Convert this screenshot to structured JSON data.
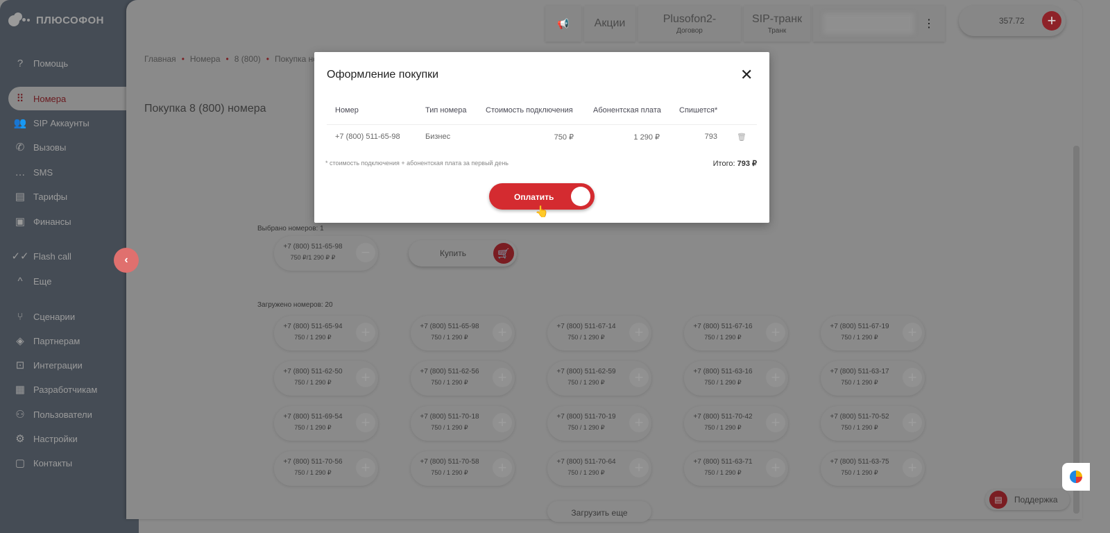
{
  "app": {
    "logo": "ПЛЮСОФОН"
  },
  "sidebar": {
    "items": [
      {
        "label": "Помощь",
        "icon": "help-icon"
      },
      {
        "label": "Номера",
        "icon": "dialpad-icon",
        "active": true
      },
      {
        "label": "SIP Аккаунты",
        "icon": "people-icon"
      },
      {
        "label": "Вызовы",
        "icon": "phone-icon"
      },
      {
        "label": "SMS",
        "icon": "sms-icon"
      },
      {
        "label": "Тарифы",
        "icon": "tariff-icon"
      },
      {
        "label": "Финансы",
        "icon": "wallet-icon"
      },
      {
        "label": "Flash call",
        "icon": "double-check-icon"
      },
      {
        "label": "Еще",
        "icon": "chevron-up-icon"
      },
      {
        "label": "Сценарии",
        "icon": "split-icon"
      },
      {
        "label": "Партнерам",
        "icon": "tag-icon"
      },
      {
        "label": "Интеграции",
        "icon": "integration-icon"
      },
      {
        "label": "Разработчикам",
        "icon": "code-icon"
      },
      {
        "label": "Пользователи",
        "icon": "users-icon"
      },
      {
        "label": "Настройки",
        "icon": "gear-icon"
      },
      {
        "label": "Контакты",
        "icon": "contacts-icon"
      }
    ]
  },
  "header": {
    "promo": "Акции",
    "contract": "Plusofon2-",
    "contract_label": "Договор",
    "trunk": "SIP-транк",
    "trunk_label": "Транк",
    "balance": "357.72"
  },
  "breadcrumb": [
    "Главная",
    "Номера",
    "8 (800)",
    "Покупка номера"
  ],
  "page": {
    "title": "Покупка 8 (800) номера",
    "selected_label": "Выбрано номеров: 1",
    "loaded_label": "Загружено номеров: 20",
    "buy_label": "Купить",
    "load_more": "Загрузить еще",
    "support": "Поддержка",
    "selected": [
      {
        "number": "+7 (800) 511-65-98",
        "price": "750 ₽/1 290 ₽ ₽"
      }
    ],
    "numbers": [
      {
        "number": "+7 (800) 511-65-94",
        "price": "750 / 1 290 ₽"
      },
      {
        "number": "+7 (800) 511-65-98",
        "price": "750 / 1 290 ₽"
      },
      {
        "number": "+7 (800) 511-67-14",
        "price": "750 / 1 290 ₽"
      },
      {
        "number": "+7 (800) 511-67-16",
        "price": "750 / 1 290 ₽"
      },
      {
        "number": "+7 (800) 511-67-19",
        "price": "750 / 1 290 ₽"
      },
      {
        "number": "+7 (800) 511-62-50",
        "price": "750 / 1 290 ₽"
      },
      {
        "number": "+7 (800) 511-62-56",
        "price": "750 / 1 290 ₽"
      },
      {
        "number": "+7 (800) 511-62-59",
        "price": "750 / 1 290 ₽"
      },
      {
        "number": "+7 (800) 511-63-16",
        "price": "750 / 1 290 ₽"
      },
      {
        "number": "+7 (800) 511-63-17",
        "price": "750 / 1 290 ₽"
      },
      {
        "number": "+7 (800) 511-69-54",
        "price": "750 / 1 290 ₽"
      },
      {
        "number": "+7 (800) 511-70-18",
        "price": "750 / 1 290 ₽"
      },
      {
        "number": "+7 (800) 511-70-19",
        "price": "750 / 1 290 ₽"
      },
      {
        "number": "+7 (800) 511-70-42",
        "price": "750 / 1 290 ₽"
      },
      {
        "number": "+7 (800) 511-70-52",
        "price": "750 / 1 290 ₽"
      },
      {
        "number": "+7 (800) 511-70-56",
        "price": "750 / 1 290 ₽"
      },
      {
        "number": "+7 (800) 511-70-58",
        "price": "750 / 1 290 ₽"
      },
      {
        "number": "+7 (800) 511-70-64",
        "price": "750 / 1 290 ₽"
      },
      {
        "number": "+7 (800) 511-63-71",
        "price": "750 / 1 290 ₽"
      },
      {
        "number": "+7 (800) 511-63-75",
        "price": "750 / 1 290 ₽"
      }
    ]
  },
  "modal": {
    "title": "Оформление покупки",
    "columns": [
      "Номер",
      "Тип номера",
      "Стоимость подключения",
      "Абонентская плата",
      "Спишется*"
    ],
    "rows": [
      {
        "number": "+7 (800) 511-65-98",
        "type": "Бизнес",
        "connection": "750 ₽",
        "monthly": "1 290 ₽",
        "charge": "793"
      }
    ],
    "note": "* стоимость подключения + абонентская плата за первый день",
    "total_label": "Итого:",
    "total": "793 ₽",
    "pay_label": "Оплатить"
  },
  "colors": {
    "accent": "#d42b30",
    "sidebar": "#454c55"
  }
}
